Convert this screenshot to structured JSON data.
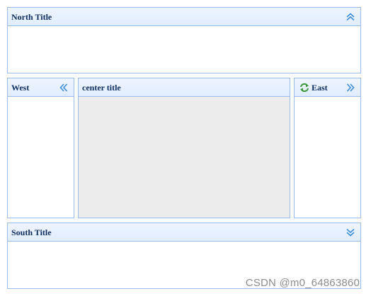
{
  "north": {
    "title": "North Title",
    "tool_icon": "double-chevron-up-icon"
  },
  "west": {
    "title": "West",
    "tool_icon": "double-chevron-left-icon"
  },
  "center": {
    "title": "center title"
  },
  "east": {
    "title": "East",
    "title_icon": "refresh-icon",
    "tool_icon": "double-chevron-right-icon"
  },
  "south": {
    "title": "South Title",
    "tool_icon": "double-chevron-down-icon"
  },
  "watermark": "CSDN @m0_64863860",
  "colors": {
    "border": "#99bbe8",
    "header_top": "#eff5ff",
    "header_bottom": "#e0ecff",
    "title_text": "#0e2d5f",
    "center_bg": "#ececec",
    "tool_icon": "#3d8fd6"
  }
}
